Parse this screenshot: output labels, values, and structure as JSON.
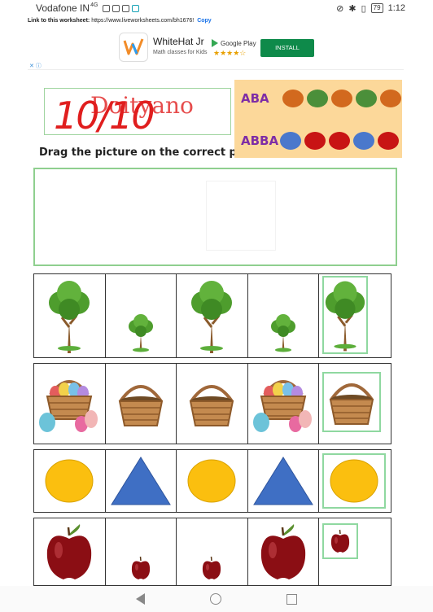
{
  "status_bar": {
    "carrier": "Vodafone IN",
    "network": "4G",
    "battery": "79",
    "time": "1:12"
  },
  "link_bar": {
    "label": "Link to this worksheet:",
    "url": "https://www.liveworksheets.com/bh1676!",
    "copy": "Copy"
  },
  "ad": {
    "app_name": "WhiteHat Jr",
    "tagline": "Math classes for Kids",
    "store": "Google Play",
    "stars": "★★★★☆",
    "install": "INSTALL",
    "choices": "✕ ⓘ"
  },
  "worksheet": {
    "name_scrawl": "Doityano",
    "score": "10/10",
    "instruction": "Drag the picture on the correct place",
    "pattern_legend": [
      {
        "label": "ABA",
        "dots": [
          "#d2691e",
          "#4b8f3a",
          "#d2691e",
          "#4b8f3a",
          "#d2691e"
        ]
      },
      {
        "label": "ABBA",
        "dots": [
          "#4a78cc",
          "#c81414",
          "#c81414",
          "#4a78cc",
          "#c81414"
        ]
      }
    ],
    "rows": [
      {
        "name": "trees",
        "items": [
          "big-tree",
          "small-tree",
          "big-tree",
          "small-tree",
          "big-tree"
        ]
      },
      {
        "name": "baskets",
        "items": [
          "egg-basket",
          "empty-basket",
          "empty-basket",
          "egg-basket",
          "empty-basket"
        ]
      },
      {
        "name": "shapes",
        "items": [
          "yellow-circle",
          "blue-triangle",
          "yellow-circle",
          "blue-triangle",
          "yellow-circle"
        ]
      },
      {
        "name": "apples",
        "items": [
          "big-apple",
          "small-apple",
          "small-apple",
          "big-apple",
          "small-apple"
        ]
      }
    ]
  },
  "colors": {
    "accent_green": "#8fcf8f",
    "score_red": "#e01e1e",
    "pattern_bg": "#fcd89a",
    "pattern_text": "#7e2da6",
    "install_green": "#0e8a4a"
  }
}
